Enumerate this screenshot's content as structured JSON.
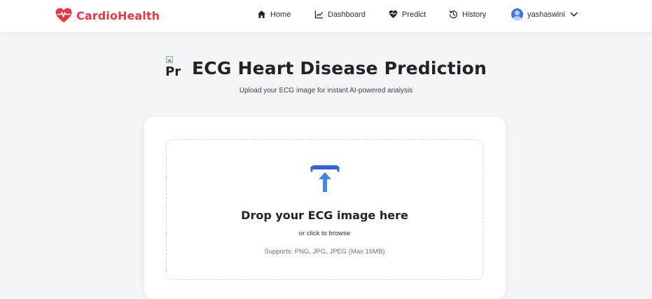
{
  "brand": {
    "name": "CardioHealth",
    "color": "#e53946"
  },
  "nav": {
    "home": "Home",
    "dashboard": "Dashboard",
    "predict": "Predict",
    "history": "History",
    "user": "yashaswini"
  },
  "header": {
    "image_alt": "Pr",
    "title": "ECG Heart Disease Prediction",
    "subtitle": "Upload your ECG image for instant AI-powered analysis"
  },
  "upload": {
    "title": "Drop your ECG image here",
    "browse": "or click to browse",
    "supports": "Supports: PNG, JPG, JPEG (Max 16MB)",
    "icon": "upload-icon",
    "accent": "#3f86e8"
  }
}
